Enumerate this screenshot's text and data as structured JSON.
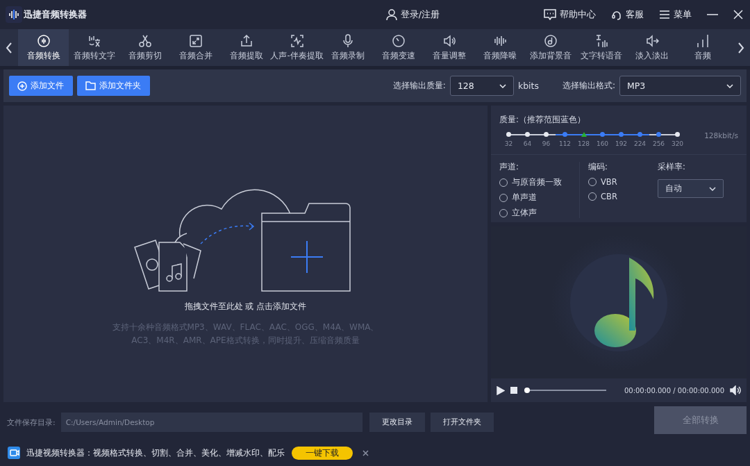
{
  "window": {
    "title": "迅捷音频转换器",
    "login": "登录/注册",
    "help": "帮助中心",
    "service": "客服",
    "menu": "菜单"
  },
  "tabs": [
    {
      "label": "音频转换",
      "selected": true
    },
    {
      "label": "音频转文字",
      "selected": false
    },
    {
      "label": "音频剪切",
      "selected": false
    },
    {
      "label": "音频合并",
      "selected": false
    },
    {
      "label": "音频提取",
      "selected": false
    },
    {
      "label": "人声-伴奏提取",
      "selected": false
    },
    {
      "label": "音频录制",
      "selected": false
    },
    {
      "label": "音频变速",
      "selected": false
    },
    {
      "label": "音量调整",
      "selected": false
    },
    {
      "label": "音频降噪",
      "selected": false
    },
    {
      "label": "添加背景音",
      "selected": false
    },
    {
      "label": "文字转语音",
      "selected": false
    },
    {
      "label": "淡入淡出",
      "selected": false
    },
    {
      "label": "音频",
      "selected": false
    }
  ],
  "actions": {
    "add_file": "添加文件",
    "add_folder": "添加文件夹",
    "quality_label": "选择输出质量:",
    "quality_value": "128",
    "quality_unit": "kbits",
    "format_label": "选择输出格式:",
    "format_value": "MP3"
  },
  "dropzone": {
    "hint": "拖拽文件至此处 或 点击添加文件",
    "description": "支持十余种音频格式MP3、WAV、FLAC、AAC、OGG、M4A、WMA、AC3、M4R、AMR、APE格式转换，同时提升、压缩音频质量"
  },
  "settings": {
    "quality_title": "质量:（推荐范围蓝色）",
    "quality_reading": "128kbit/s",
    "quality_steps": [
      {
        "label": "32",
        "recommended": false,
        "selected": false
      },
      {
        "label": "64",
        "recommended": false,
        "selected": false
      },
      {
        "label": "96",
        "recommended": false,
        "selected": false
      },
      {
        "label": "112",
        "recommended": true,
        "selected": false
      },
      {
        "label": "128",
        "recommended": true,
        "selected": true
      },
      {
        "label": "160",
        "recommended": true,
        "selected": false
      },
      {
        "label": "192",
        "recommended": true,
        "selected": false
      },
      {
        "label": "224",
        "recommended": true,
        "selected": false
      },
      {
        "label": "256",
        "recommended": true,
        "selected": false
      },
      {
        "label": "320",
        "recommended": false,
        "selected": false
      }
    ],
    "channel_label": "声道:",
    "channels": [
      {
        "label": "与原音频一致",
        "checked": false
      },
      {
        "label": "单声道",
        "checked": false
      },
      {
        "label": "立体声",
        "checked": false
      }
    ],
    "encoding_label": "编码:",
    "encodings": [
      {
        "label": "VBR",
        "checked": false
      },
      {
        "label": "CBR",
        "checked": false
      }
    ],
    "sample_rate_label": "采样率:",
    "sample_rate_value": "自动"
  },
  "player": {
    "level": 0,
    "time": "00:00:00.000 / 00:00:00.000"
  },
  "footer": {
    "save_label": "文件保存目录:",
    "save_path": "C:/Users/Admin/Desktop",
    "change_dir": "更改目录",
    "open_folder": "打开文件夹",
    "convert_all": "全部转换"
  },
  "ad": {
    "text": "迅捷视频转换器：视频格式转换、切割、合并、美化、增减水印、配乐",
    "download": "一键下载"
  }
}
